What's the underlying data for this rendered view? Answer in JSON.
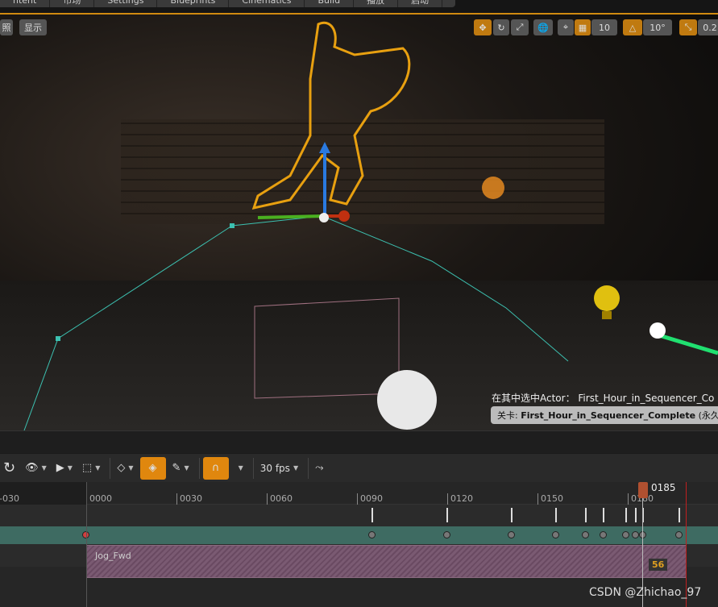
{
  "menu": [
    "ntent",
    "市场",
    "Settings",
    "Blueprints",
    "Cinematics",
    "Build",
    "播放",
    "启动"
  ],
  "viewport": {
    "left_buttons": [
      "照",
      "显示"
    ],
    "grid_snap": "10",
    "rotation_snap": "10°",
    "scale_snap": "0.2",
    "selected_actor_label": "在其中选中Actor：",
    "selected_actor": "First_Hour_in_Sequencer_Co",
    "level_label": "关卡:",
    "level_name": "First_Hour_in_Sequencer_Complete",
    "level_suffix": "(永久性)"
  },
  "toolbar": {
    "fps": "30 fps"
  },
  "timeline": {
    "ticks": [
      "-030",
      "0000",
      "0030",
      "0060",
      "0090",
      "0120",
      "0150",
      "0180"
    ],
    "current_frame": "0185",
    "section_name": "Jog_Fwd",
    "section_badge": "56"
  },
  "watermark": "CSDN @Zhichao_97"
}
